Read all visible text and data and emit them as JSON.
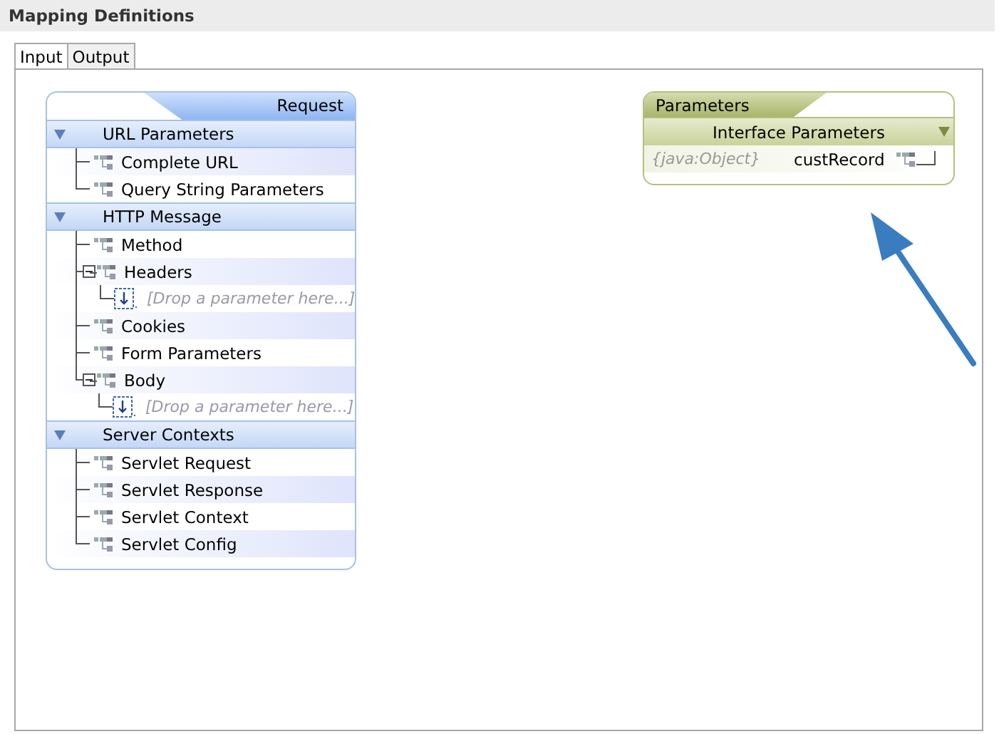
{
  "panel": {
    "title": "Mapping Definitions"
  },
  "tabs": [
    {
      "label": "Input",
      "selected": true
    },
    {
      "label": "Output",
      "selected": false
    }
  ],
  "request": {
    "title": "Request",
    "sections": [
      {
        "label": "URL Parameters",
        "expanded": true,
        "children": [
          {
            "kind": "leaf",
            "label": "Complete URL"
          },
          {
            "kind": "leaf",
            "label": "Query String Parameters"
          }
        ]
      },
      {
        "label": "HTTP Message",
        "expanded": true,
        "children": [
          {
            "kind": "leaf",
            "label": "Method"
          },
          {
            "kind": "leaf",
            "label": "Headers",
            "expanded": true,
            "children": [
              {
                "kind": "drop",
                "label": "[Drop a parameter here...]"
              }
            ]
          },
          {
            "kind": "leaf",
            "label": "Cookies"
          },
          {
            "kind": "leaf",
            "label": "Form Parameters"
          },
          {
            "kind": "leaf",
            "label": "Body",
            "expanded": true,
            "children": [
              {
                "kind": "drop",
                "label": "[Drop a parameter here...]"
              }
            ]
          }
        ]
      },
      {
        "label": "Server Contexts",
        "expanded": true,
        "children": [
          {
            "kind": "leaf",
            "label": "Servlet Request"
          },
          {
            "kind": "leaf",
            "label": "Servlet Response"
          },
          {
            "kind": "leaf",
            "label": "Servlet Context"
          },
          {
            "kind": "leaf",
            "label": "Servlet Config"
          }
        ]
      }
    ]
  },
  "parameters": {
    "title": "Parameters",
    "header": "Interface Parameters",
    "rows": [
      {
        "type": "{java:Object}",
        "name": "custRecord"
      }
    ]
  }
}
